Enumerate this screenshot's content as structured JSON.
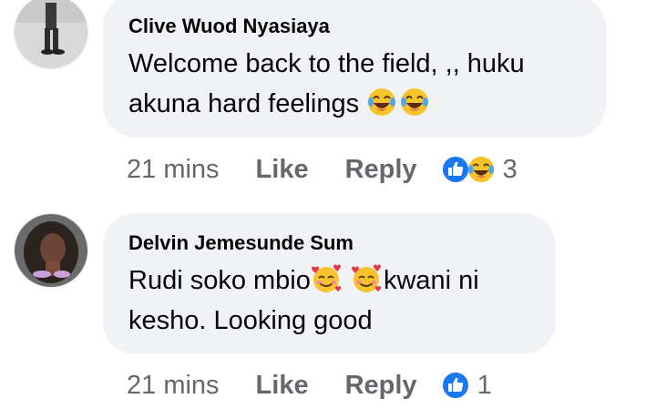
{
  "comments": [
    {
      "author": "Clive Wuod Nyasiaya",
      "line1": "Welcome back to the field, ,, huku",
      "line2": "akuna hard feelings",
      "time": "21 mins",
      "like_label": "Like",
      "reply_label": "Reply",
      "reaction_count": "3",
      "reaction_icons": [
        "like-icon",
        "laugh-emoji-icon"
      ]
    },
    {
      "author": "Delvin Jemesunde Sum",
      "line1_a": "Rudi soko mbio",
      "line1_b": "kwani ni",
      "line2": "kesho. Looking good",
      "time": "21 mins",
      "like_label": "Like",
      "reply_label": "Reply",
      "reaction_count": "1",
      "reaction_icons": [
        "like-icon"
      ]
    }
  ],
  "colors": {
    "bubble": "#f0f2f5",
    "text": "#050505",
    "meta": "#65676b",
    "like_blue": "#1877f2",
    "emoji_yellow": "#f7b125"
  }
}
